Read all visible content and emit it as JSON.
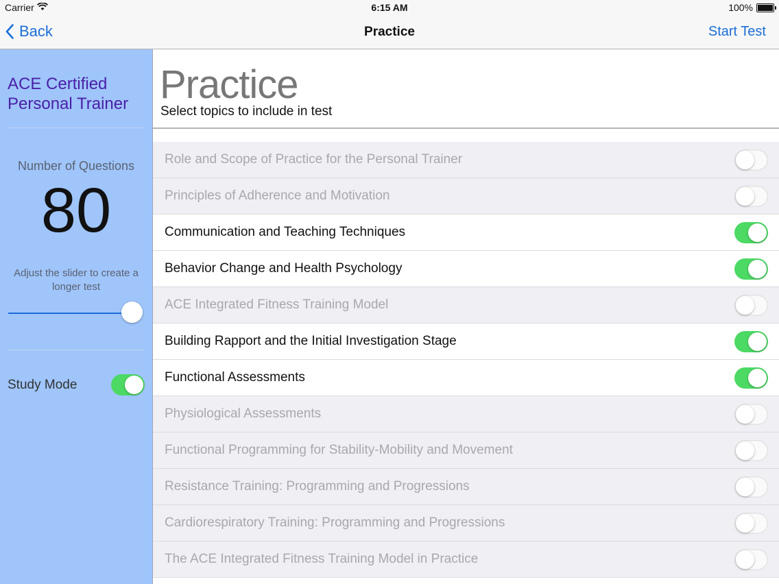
{
  "status_bar": {
    "carrier": "Carrier",
    "time": "6:15 AM",
    "battery": "100%"
  },
  "nav": {
    "back_label": "Back",
    "title": "Practice",
    "start_label": "Start Test"
  },
  "sidebar": {
    "app_title": "ACE Certified Personal Trainer",
    "questions_label": "Number of Questions",
    "questions_value": "80",
    "slider_hint": "Adjust the slider to create a longer test",
    "slider_level": 1.0,
    "study_mode_label": "Study Mode",
    "study_mode_on": true
  },
  "main": {
    "title": "Practice",
    "subtitle": "Select topics to include in test"
  },
  "topics": [
    {
      "label": "Role and Scope of Practice for the Personal Trainer",
      "on": false
    },
    {
      "label": "Principles of Adherence and Motivation",
      "on": false
    },
    {
      "label": "Communication and Teaching Techniques",
      "on": true
    },
    {
      "label": "Behavior Change and Health Psychology",
      "on": true
    },
    {
      "label": "ACE Integrated Fitness Training Model",
      "on": false
    },
    {
      "label": "Building Rapport and the Initial Investigation Stage",
      "on": true
    },
    {
      "label": "Functional Assessments",
      "on": true
    },
    {
      "label": "Physiological Assessments",
      "on": false
    },
    {
      "label": "Functional Programming for Stability-Mobility and Movement",
      "on": false
    },
    {
      "label": "Resistance Training: Programming and Progressions",
      "on": false
    },
    {
      "label": "Cardiorespiratory Training: Programming and Progressions",
      "on": false
    },
    {
      "label": "The ACE Integrated Fitness Training Model in Practice",
      "on": false
    }
  ],
  "colors": {
    "accent": "#1a6ed8",
    "toggle_on": "#4cd964",
    "sidebar": "#9fc5fb",
    "app_title": "#4a20a8"
  }
}
